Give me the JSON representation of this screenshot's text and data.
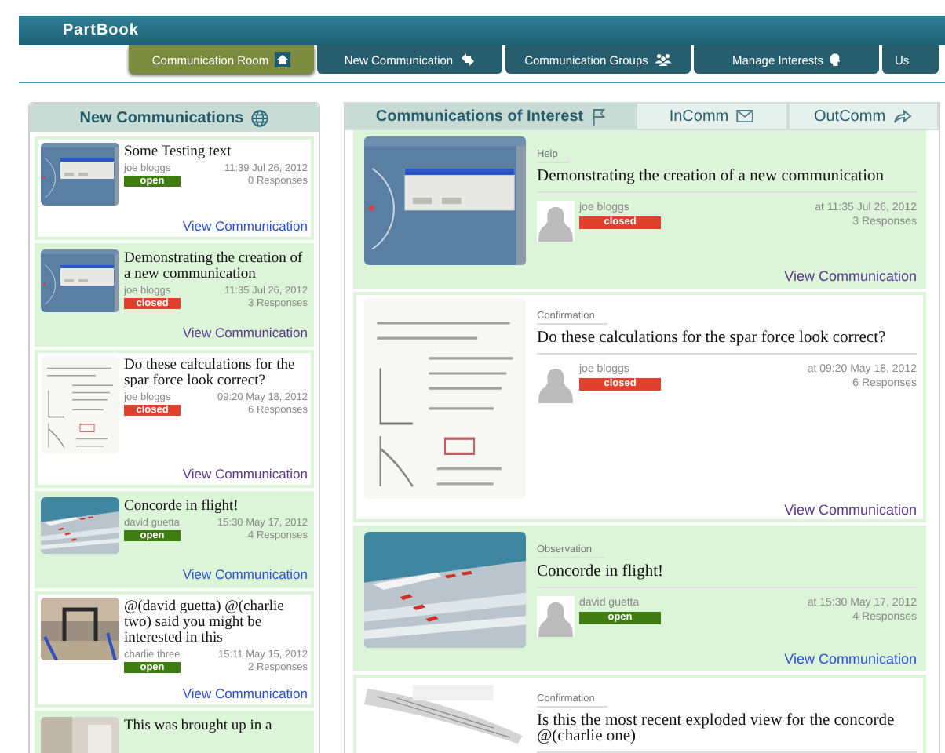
{
  "app": {
    "title": "PartBook"
  },
  "nav": [
    {
      "label": "Communication Room",
      "selected": true
    },
    {
      "label": "New Communication",
      "selected": false
    },
    {
      "label": "Communication Groups",
      "selected": false
    },
    {
      "label": "Manage Interests",
      "selected": false
    },
    {
      "label": "Us",
      "selected": false
    }
  ],
  "new_communications": {
    "title": "New Communications",
    "items": [
      {
        "title": "Some Testing text",
        "author": "joe bloggs",
        "status": "open",
        "time": "11:39 Jul 26, 2012",
        "responses": "0 Responses",
        "link": "View Communication",
        "highlighted": false,
        "visited": false
      },
      {
        "title": "Demonstrating the creation of a new communication",
        "author": "joe bloggs",
        "status": "closed",
        "time": "11:35 Jul 26, 2012",
        "responses": "3 Responses",
        "link": "View Communication",
        "highlighted": true,
        "visited": true
      },
      {
        "title": "Do these calculations for the spar force look correct?",
        "author": "joe bloggs",
        "status": "closed",
        "time": "09:20 May 18, 2012",
        "responses": "6 Responses",
        "link": "View Communication",
        "highlighted": false,
        "visited": true
      },
      {
        "title": "Concorde in flight!",
        "author": "david guetta",
        "status": "open",
        "time": "15:30 May 17, 2012",
        "responses": "4 Responses",
        "link": "View Communication",
        "highlighted": true,
        "visited": false
      },
      {
        "title": "@(david guetta) @(charlie two) said you might be interested in this",
        "author": "charlie three",
        "status": "open",
        "time": "15:11 May 15, 2012",
        "responses": "2 Responses",
        "link": "View Communication",
        "highlighted": false,
        "visited": false
      },
      {
        "title": "This was brought up in a",
        "highlighted": true
      }
    ]
  },
  "interest": {
    "tabs": [
      {
        "label": "Communications of Interest",
        "selected": true
      },
      {
        "label": "InComm",
        "selected": false
      },
      {
        "label": "OutComm",
        "selected": false
      }
    ],
    "items": [
      {
        "category": "Help",
        "title": "Demonstrating the creation of a new communication",
        "author": "joe bloggs",
        "status": "closed",
        "time": "at 11:35 Jul 26, 2012",
        "responses": "3 Responses",
        "link": "View Communication",
        "highlighted": true,
        "visited": true
      },
      {
        "category": "Confirmation",
        "title": "Do these calculations for the spar force look correct?",
        "author": "joe bloggs",
        "status": "closed",
        "time": "at 09:20 May 18, 2012",
        "responses": "6 Responses",
        "link": "View Communication",
        "highlighted": false,
        "visited": true
      },
      {
        "category": "Observation",
        "title": "Concorde in flight!",
        "author": "david guetta",
        "status": "open",
        "time": "at 15:30 May 17, 2012",
        "responses": "4 Responses",
        "link": "View Communication",
        "highlighted": true,
        "visited": false
      },
      {
        "category": "Confirmation",
        "title": "Is this the most recent exploded view for the concorde @(charlie one)",
        "highlighted": false
      }
    ]
  }
}
